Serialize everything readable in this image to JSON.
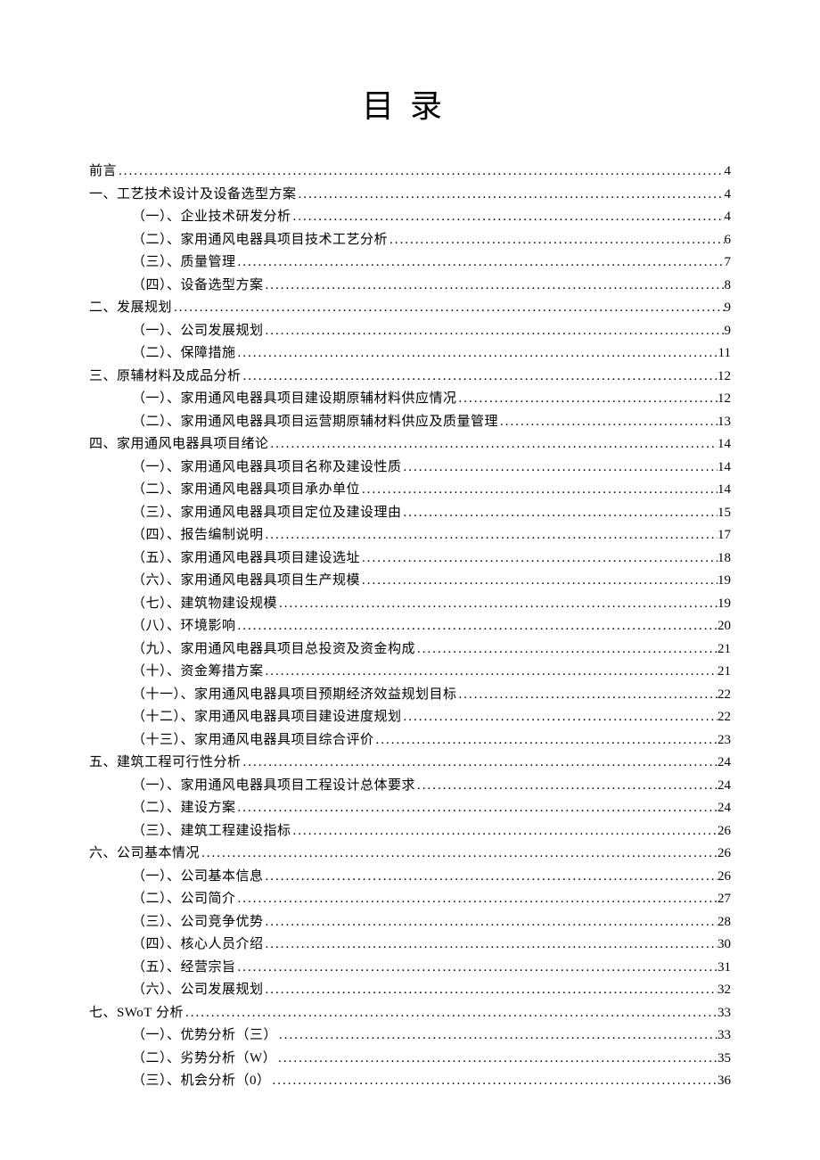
{
  "title": "目录",
  "entries": [
    {
      "level": 0,
      "text": "前言",
      "page": "4"
    },
    {
      "level": 0,
      "text": "一、工艺技术设计及设备选型方案",
      "page": "4"
    },
    {
      "level": 1,
      "text": "（一）、企业技术研发分析",
      "page": "4"
    },
    {
      "level": 1,
      "text": "（二）、家用通风电器具项目技术工艺分析",
      "page": "6"
    },
    {
      "level": 1,
      "text": "（三）、质量管理",
      "page": "7"
    },
    {
      "level": 1,
      "text": "（四）、设备选型方案",
      "page": "8"
    },
    {
      "level": 0,
      "text": "二、发展规划",
      "page": "9"
    },
    {
      "level": 1,
      "text": "（一）、公司发展规划",
      "page": "9"
    },
    {
      "level": 1,
      "text": "（二）、保障措施",
      "page": "11"
    },
    {
      "level": 0,
      "text": "三、原辅材料及成品分析",
      "page": "12"
    },
    {
      "level": 1,
      "text": "（一）、家用通风电器具项目建设期原辅材料供应情况",
      "page": "12"
    },
    {
      "level": 1,
      "text": "（二）、家用通风电器具项目运营期原辅材料供应及质量管理",
      "page": "13"
    },
    {
      "level": 0,
      "text": "四、家用通风电器具项目绪论",
      "page": "14"
    },
    {
      "level": 1,
      "text": "（一）、家用通风电器具项目名称及建设性质",
      "page": "14"
    },
    {
      "level": 1,
      "text": "（二）、家用通风电器具项目承办单位",
      "page": "14"
    },
    {
      "level": 1,
      "text": "（三）、家用通风电器具项目定位及建设理由",
      "page": "15"
    },
    {
      "level": 1,
      "text": "（四）、报告编制说明",
      "page": "17"
    },
    {
      "level": 1,
      "text": "（五）、家用通风电器具项目建设选址",
      "page": "18"
    },
    {
      "level": 1,
      "text": "（六）、家用通风电器具项目生产规模",
      "page": "19"
    },
    {
      "level": 1,
      "text": "（七）、建筑物建设规模",
      "page": "19"
    },
    {
      "level": 1,
      "text": "（八）、环境影响",
      "page": "20"
    },
    {
      "level": 1,
      "text": "（九）、家用通风电器具项目总投资及资金构成",
      "page": "21"
    },
    {
      "level": 1,
      "text": "（十）、资金筹措方案",
      "page": "21"
    },
    {
      "level": 1,
      "text": "（十一）、家用通风电器具项目预期经济效益规划目标",
      "page": "22"
    },
    {
      "level": 1,
      "text": "（十二）、家用通风电器具项目建设进度规划",
      "page": "22"
    },
    {
      "level": 1,
      "text": "（十三）、家用通风电器具项目综合评价",
      "page": "23"
    },
    {
      "level": 0,
      "text": "五、建筑工程可行性分析",
      "page": "24"
    },
    {
      "level": 1,
      "text": "（一）、家用通风电器具项目工程设计总体要求",
      "page": "24"
    },
    {
      "level": 1,
      "text": "（二）、建设方案",
      "page": "24"
    },
    {
      "level": 1,
      "text": "（三）、建筑工程建设指标",
      "page": "26"
    },
    {
      "level": 0,
      "text": "六、公司基本情况",
      "page": "26"
    },
    {
      "level": 1,
      "text": "（一）、公司基本信息",
      "page": "26"
    },
    {
      "level": 1,
      "text": "（二）、公司简介",
      "page": "27"
    },
    {
      "level": 1,
      "text": "（三）、公司竞争优势",
      "page": "28"
    },
    {
      "level": 1,
      "text": "（四）、核心人员介绍",
      "page": "30"
    },
    {
      "level": 1,
      "text": "（五）、经营宗旨",
      "page": "31"
    },
    {
      "level": 1,
      "text": "（六）、公司发展规划",
      "page": "32"
    },
    {
      "level": 0,
      "text": "七、SWoT 分析",
      "page": "33"
    },
    {
      "level": 1,
      "text": "（一）、优势分析（三）",
      "page": "33"
    },
    {
      "level": 1,
      "text": "（二）、劣势分析（W）",
      "page": "35"
    },
    {
      "level": 1,
      "text": "（三）、机会分析（0）",
      "page": "36"
    }
  ]
}
